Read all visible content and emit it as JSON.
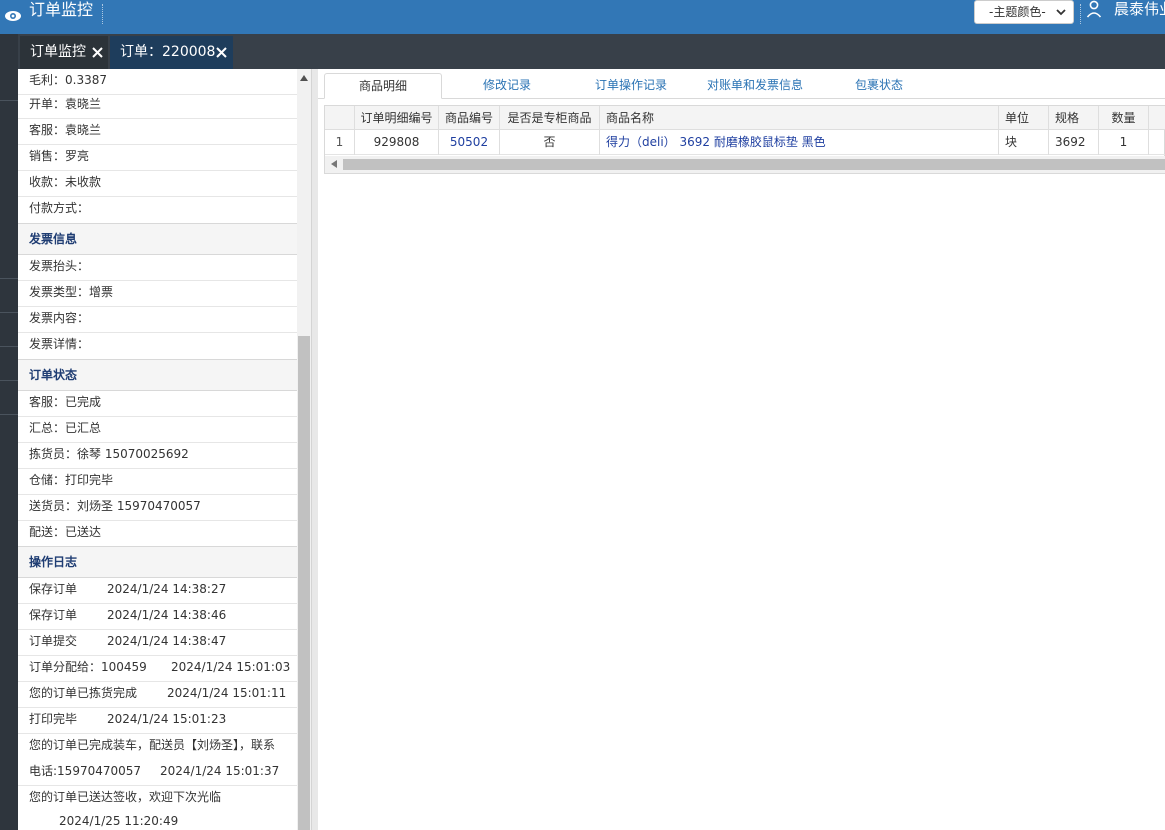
{
  "header": {
    "title": "订单监控",
    "theme_select": "-主题颜色-",
    "user_name": "晨泰伟业"
  },
  "tabs": [
    {
      "label": "订单监控"
    },
    {
      "label": "订单：220008"
    }
  ],
  "left": {
    "basic_rows": [
      {
        "text": "毛利：0.3387"
      },
      {
        "text": "开单：袁晓兰"
      },
      {
        "text": "客服：袁晓兰"
      },
      {
        "text": "销售：罗亮"
      },
      {
        "text": "收款：未收款"
      },
      {
        "text": "付款方式："
      }
    ],
    "invoice": {
      "title": "发票信息",
      "rows": [
        {
          "text": "发票抬头："
        },
        {
          "text": "发票类型：增票"
        },
        {
          "text": "发票内容："
        },
        {
          "text": "发票详情："
        }
      ]
    },
    "status": {
      "title": "订单状态",
      "rows": [
        {
          "text": "客服：已完成"
        },
        {
          "text": "汇总：已汇总"
        },
        {
          "text": "拣货员：徐琴 15070025692"
        },
        {
          "text": "仓储：打印完毕"
        },
        {
          "text": "送货员：刘炀圣 15970470057"
        },
        {
          "text": "配送：已送达"
        }
      ]
    },
    "log": {
      "title": "操作日志",
      "rows": [
        {
          "action": "保存订单",
          "time": "2024/1/24 14:38:27"
        },
        {
          "action": "保存订单",
          "time": "2024/1/24 14:38:46"
        },
        {
          "action": "订单提交",
          "time": "2024/1/24 14:38:47"
        },
        {
          "action": "订单分配给：100459",
          "time": "2024/1/24 15:01:03"
        },
        {
          "action": "您的订单已拣货完成",
          "time": "2024/1/24 15:01:11"
        },
        {
          "action": "打印完毕",
          "time": "2024/1/24 15:01:23"
        },
        {
          "action": "您的订单已完成装车，配送员【刘炀圣】，联系",
          "action2": "电话:15970470057",
          "time": "2024/1/24 15:01:37"
        },
        {
          "action": "您的订单已送达签收，欢迎下次光临",
          "time": "2024/1/25 11:20:49"
        }
      ]
    }
  },
  "detail_tabs": [
    {
      "label": "商品明细"
    },
    {
      "label": "修改记录"
    },
    {
      "label": "订单操作记录"
    },
    {
      "label": "对账单和发票信息"
    },
    {
      "label": "包裹状态"
    }
  ],
  "grid": {
    "columns": [
      "订单明细编号",
      "商品编号",
      "是否是专柜商品",
      "商品名称",
      "单位",
      "规格",
      "数量"
    ],
    "rows": [
      {
        "index": "1",
        "detail_id": "929808",
        "product_id": "50502",
        "is_counter": "否",
        "name": "得力（deli） 3692 耐磨橡胶鼠标垫 黑色",
        "unit": "块",
        "spec": "3692",
        "qty": "1"
      }
    ]
  },
  "colors": {
    "header_bg": "#3277b6",
    "tabbar_bg": "#384049",
    "active_tab_bg": "#1e3d5c",
    "section_title": "#1f3d73",
    "link": "#2a73b4"
  }
}
